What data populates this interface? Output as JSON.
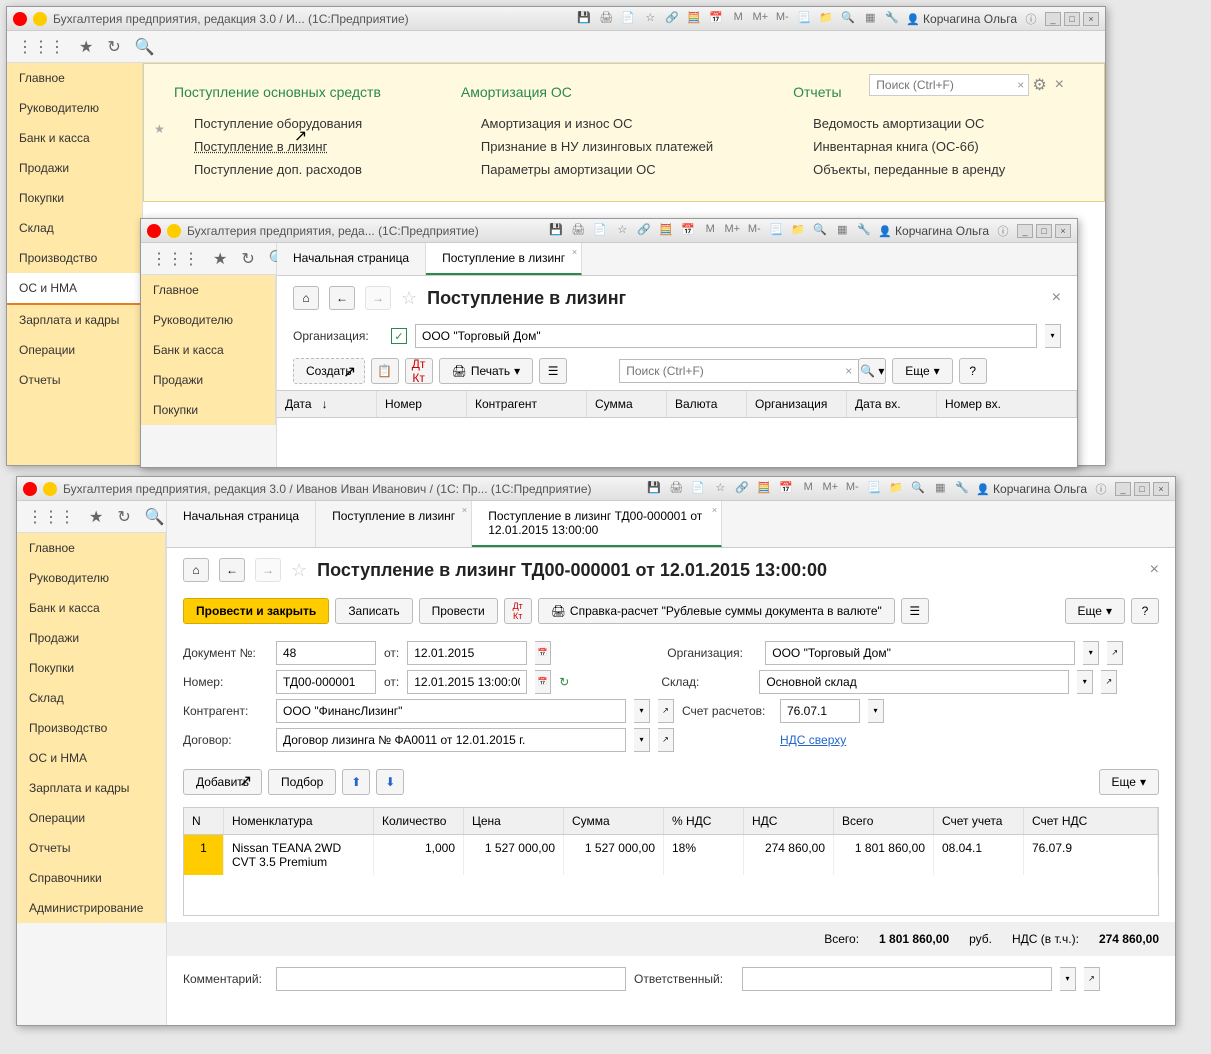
{
  "user": "Корчагина Ольга",
  "w1": {
    "title": "Бухгалтерия предприятия, редакция 3.0 / И...  (1С:Предприятие)",
    "search_ph": "Поиск (Ctrl+F)",
    "sidebar": [
      "Главное",
      "Руководителю",
      "Банк и касса",
      "Продажи",
      "Покупки",
      "Склад",
      "Производство",
      "ОС и НМА",
      "Зарплата и кадры",
      "Операции",
      "Отчеты"
    ],
    "col1_h": "Поступление основных средств",
    "col1": [
      "Поступление оборудования",
      "Поступление в лизинг",
      "Поступление доп. расходов"
    ],
    "col2_h": "Амортизация ОС",
    "col2": [
      "Амортизация и износ ОС",
      "Признание в НУ лизинговых платежей",
      "Параметры амортизации ОС"
    ],
    "col3_h": "Отчеты",
    "col3": [
      "Ведомость амортизации ОС",
      "Инвентарная книга (ОС-6б)",
      "Объекты, переданные в аренду"
    ]
  },
  "w2": {
    "title": "Бухгалтерия предприятия, реда...  (1С:Предприятие)",
    "sidebar": [
      "Главное",
      "Руководителю",
      "Банк и касса",
      "Продажи",
      "Покупки"
    ],
    "tabs": [
      "Начальная страница",
      "Поступление в лизинг"
    ],
    "page_title": "Поступление в лизинг",
    "org_label": "Организация:",
    "org_value": "ООО \"Торговый Дом\"",
    "create": "Создать",
    "print": "Печать",
    "more": "Еще",
    "search_ph": "Поиск (Ctrl+F)",
    "cols": [
      "Дата",
      "Номер",
      "Контрагент",
      "Сумма",
      "Валюта",
      "Организация",
      "Дата вх.",
      "Номер вх."
    ]
  },
  "w3": {
    "title": "Бухгалтерия предприятия, редакция 3.0 / Иванов Иван Иванович / (1С: Пр...  (1С:Предприятие)",
    "sidebar": [
      "Главное",
      "Руководителю",
      "Банк и касса",
      "Продажи",
      "Покупки",
      "Склад",
      "Производство",
      "ОС и НМА",
      "Зарплата и кадры",
      "Операции",
      "Отчеты",
      "Справочники",
      "Администрирование"
    ],
    "tabs": [
      "Начальная страница",
      "Поступление в лизинг",
      "Поступление в лизинг ТД00-000001 от 12.01.2015 13:00:00"
    ],
    "page_title": "Поступление в лизинг ТД00-000001 от 12.01.2015 13:00:00",
    "btn_post_close": "Провести и закрыть",
    "btn_save": "Записать",
    "btn_post": "Провести",
    "btn_report": "Справка-расчет \"Рублевые суммы документа в валюте\"",
    "more": "Еще",
    "doc_no_label": "Документ №:",
    "doc_no": "48",
    "from": "от:",
    "doc_date": "12.01.2015",
    "num_label": "Номер:",
    "num": "ТД00-000001",
    "num_date": "12.01.2015 13:00:00",
    "org_label": "Организация:",
    "org": "ООО \"Торговый Дом\"",
    "wh_label": "Склад:",
    "wh": "Основной склад",
    "ctr_label": "Контрагент:",
    "ctr": "ООО \"ФинансЛизинг\"",
    "acc_label": "Счет расчетов:",
    "acc": "76.07.1",
    "agr_label": "Договор:",
    "agr": "Договор лизинга № ФА0011 от 12.01.2015 г.",
    "vat_link": "НДС сверху",
    "add": "Добавить",
    "pick": "Подбор",
    "grid_cols": [
      "N",
      "Номенклатура",
      "Количество",
      "Цена",
      "Сумма",
      "% НДС",
      "НДС",
      "Всего",
      "Счет учета",
      "Счет НДС"
    ],
    "row": {
      "n": "1",
      "nom": "Nissan TEANA 2WD CVT 3.5 Premium",
      "qty": "1,000",
      "price": "1 527 000,00",
      "sum": "1 527 000,00",
      "vat_pct": "18%",
      "vat": "274 860,00",
      "total": "1 801 860,00",
      "acc": "08.04.1",
      "acc_vat": "76.07.9"
    },
    "totals": {
      "label_total": "Всего:",
      "total": "1 801 860,00",
      "cur": "руб.",
      "label_vat": "НДС (в т.ч.):",
      "vat": "274 860,00"
    },
    "comment_label": "Комментарий:",
    "resp_label": "Ответственный:"
  },
  "mem": {
    "m": "M",
    "mp": "M+",
    "mm": "M-"
  }
}
